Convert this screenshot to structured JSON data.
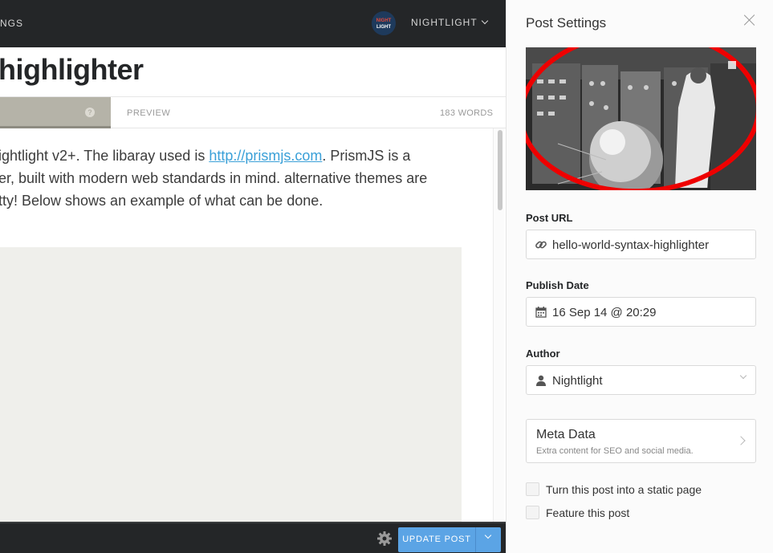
{
  "topbar": {
    "nav_partial": "NGS",
    "blog_logo_line1": "NIGHT",
    "blog_logo_line2": "LIGHT",
    "user_menu_label": "NIGHTLIGHT"
  },
  "editor": {
    "title": "highlighter",
    "tabs": {
      "help_glyph": "?",
      "preview_label": "PREVIEW",
      "word_count": "183 WORDS"
    },
    "preview": {
      "line1_before": "ightlight v2+. The libaray used is ",
      "line1_link": "http://prismjs.com",
      "line1_after": ". PrismJS is a",
      "line2": "er, built with modern web standards in mind. alternative themes are",
      "line3": "tty! Below shows an example of what can be done."
    }
  },
  "bottombar": {
    "update_button_label": "UPDATE POST"
  },
  "settings": {
    "title": "Post Settings",
    "post_url": {
      "label": "Post URL",
      "value": "hello-world-syntax-highlighter"
    },
    "publish_date": {
      "label": "Publish Date",
      "value": "16 Sep 14 @ 20:29"
    },
    "author": {
      "label": "Author",
      "value": "Nightlight"
    },
    "meta_data": {
      "title": "Meta Data",
      "description": "Extra content for SEO and social media."
    },
    "checkboxes": [
      {
        "label": "Turn this post into a static page",
        "checked": false
      },
      {
        "label": "Feature this post",
        "checked": false
      }
    ]
  },
  "colors": {
    "topbar_bg": "#242628",
    "accent_blue": "#5ba4e5",
    "link_blue": "#3aa0d8",
    "annotation_red": "#ee0000"
  },
  "icons": {
    "link": "link-icon",
    "calendar": "calendar-icon",
    "user": "user-icon",
    "gear": "gear-icon",
    "close": "close-icon"
  }
}
